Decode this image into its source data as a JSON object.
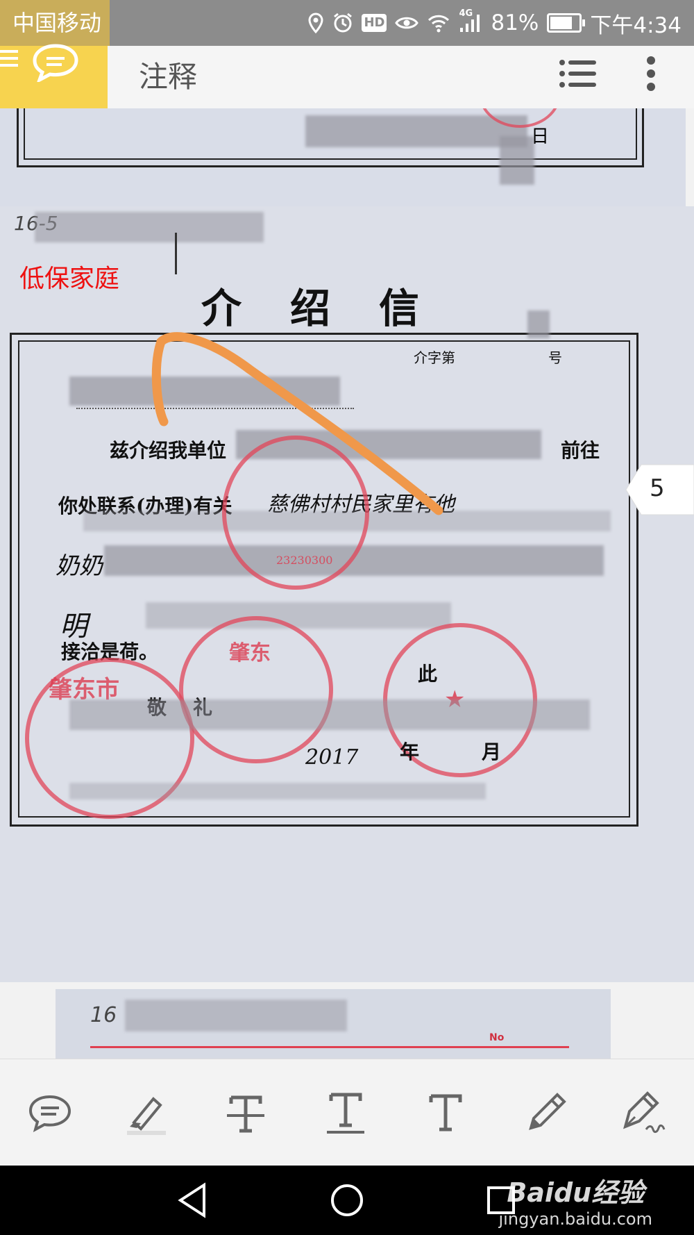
{
  "status_bar": {
    "carrier": "中国移动",
    "battery_percent": "81%",
    "time": "下午4:34",
    "battery_level": 0.81,
    "icons": [
      "location-icon",
      "alarm-icon",
      "hd-icon",
      "eye-icon",
      "wifi-icon",
      "signal-4g-icon",
      "battery-icon"
    ],
    "hd_label": "HD",
    "net_label": "4G"
  },
  "app_bar": {
    "title": "注释",
    "menu_icon": "hamburger-icon",
    "comment_icon": "comment-bubble-icon",
    "list_icon": "list-icon",
    "more_icon": "kebab-menu-icon"
  },
  "document": {
    "prev_page": {
      "day_char": "日"
    },
    "main_page": {
      "handwritten_header": "16-5",
      "annotation_text": "低保家庭",
      "title": "介绍信",
      "ref_prefix": "介字第",
      "ref_suffix": "号",
      "body_line_1": "兹介绍我单位",
      "body_line_1_end": "前往",
      "body_line_2": "你处联系(办理)有关",
      "body_line_2_hand": "慈佛村村民家里有他",
      "body_line_3_hand": "奶奶",
      "body_line_4_hand": "明",
      "body_line_5": "接洽是荷。",
      "closing_1": "此",
      "closing_2": "敬",
      "closing_3": "礼",
      "seal_text_left": "肇东市",
      "seal_text_mid": "肇东",
      "seal_number": "23230300",
      "date_year_hand": "2017",
      "date_year": "年",
      "date_month": "月",
      "page_number": "5"
    },
    "next_page": {
      "handwritten_header": "16",
      "no_label": "No"
    }
  },
  "toolbar": {
    "tools": [
      {
        "name": "comment-tool",
        "icon": "comment-icon"
      },
      {
        "name": "highlight-tool",
        "icon": "highlighter-icon"
      },
      {
        "name": "strikethrough-tool",
        "icon": "strikethrough-icon"
      },
      {
        "name": "underline-tool",
        "icon": "underline-icon"
      },
      {
        "name": "text-tool",
        "icon": "text-icon"
      },
      {
        "name": "pencil-tool",
        "icon": "pencil-icon"
      },
      {
        "name": "signature-tool",
        "icon": "fountain-pen-icon"
      }
    ],
    "text_glyph": "T"
  },
  "nav_bar": {
    "back": "back-triangle-icon",
    "home": "home-circle-icon",
    "recents": "recents-square-icon"
  },
  "watermark": {
    "brand": "Baidu经验",
    "url": "jingyan.baidu.com"
  }
}
